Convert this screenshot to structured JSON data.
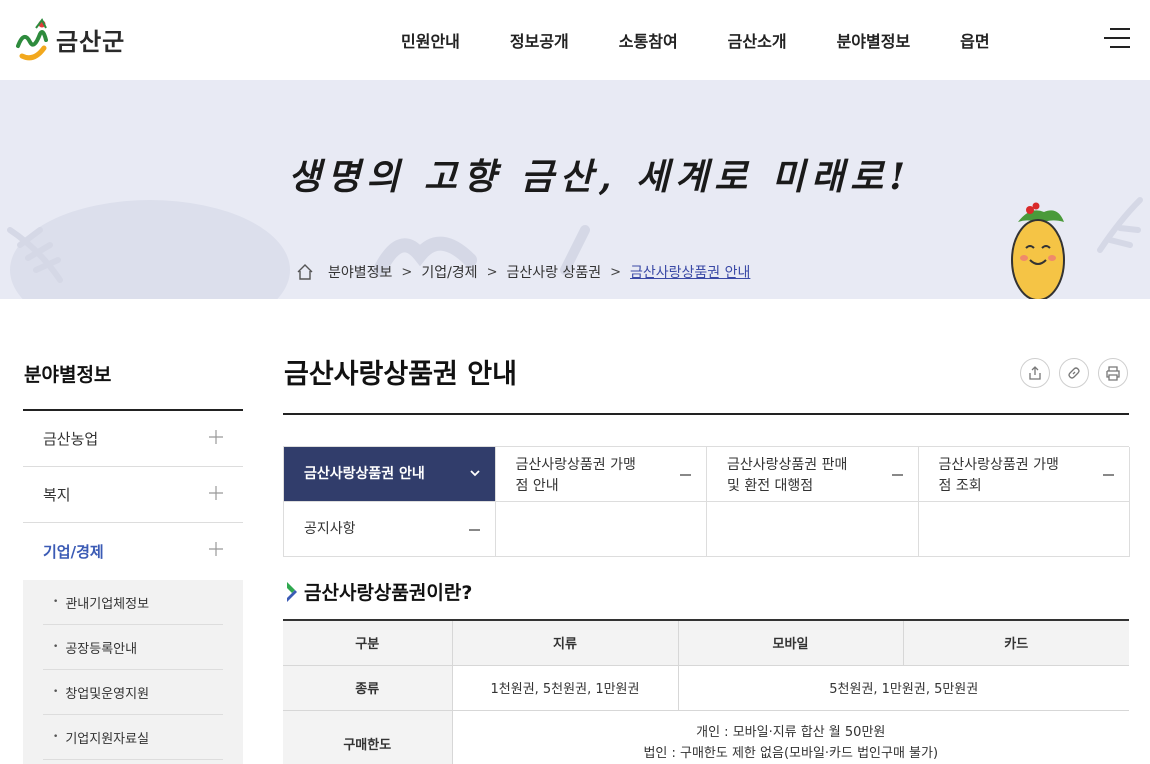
{
  "header": {
    "logo_text": "금산군",
    "nav": [
      "민원안내",
      "정보공개",
      "소통참여",
      "금산소개",
      "분야별정보",
      "읍면"
    ]
  },
  "banner": {
    "slogan": "생명의 고향 금산, 세계로 미래로!",
    "breadcrumb": [
      "분야별정보",
      "기업/경제",
      "금산사랑 상품권",
      "금산사랑상품권 안내"
    ]
  },
  "sidebar": {
    "title": "분야별정보",
    "items": [
      "금산농업",
      "복지",
      "기업/경제"
    ],
    "sub_items": [
      "관내기업체정보",
      "공장등록안내",
      "창업및운영지원",
      "기업지원자료실"
    ]
  },
  "main": {
    "title": "금산사랑상품권 안내",
    "tabs": [
      "금산사랑상품권 안내",
      "금산사랑상품권 가맹점 안내",
      "금산사랑상품권 판매및 환전 대행점",
      "금산사랑상품권 가맹점 조회",
      "공지사항"
    ],
    "tabs_lines": {
      "t1a": "금산사랑상품권 가맹",
      "t1b": "점 안내",
      "t2a": "금산사랑상품권 판매",
      "t2b": "및 환전 대행점",
      "t3a": "금산사랑상품권 가맹",
      "t3b": "점 조회"
    },
    "section_title": "금산사랑상품권이란?",
    "table": {
      "headers": [
        "구분",
        "지류",
        "모바일",
        "카드"
      ],
      "rows": [
        {
          "label": "종류",
          "paper": "1천원권, 5천원권, 1만원권",
          "mobile_card": "5천원권, 1만원권, 5만원권"
        },
        {
          "label": "구매한도",
          "line1": "개인 : 모바일·지류 합산 월 50만원",
          "line2": "법인 : 구매한도 제한 없음(모바일·카드 법인구매 불가)"
        }
      ]
    }
  },
  "colors": {
    "banner_bg": "#e8eaf4",
    "active_tab": "#313d6b",
    "accent_blue": "#3b5bb5",
    "breadcrumb_current": "#3b4aa6"
  }
}
